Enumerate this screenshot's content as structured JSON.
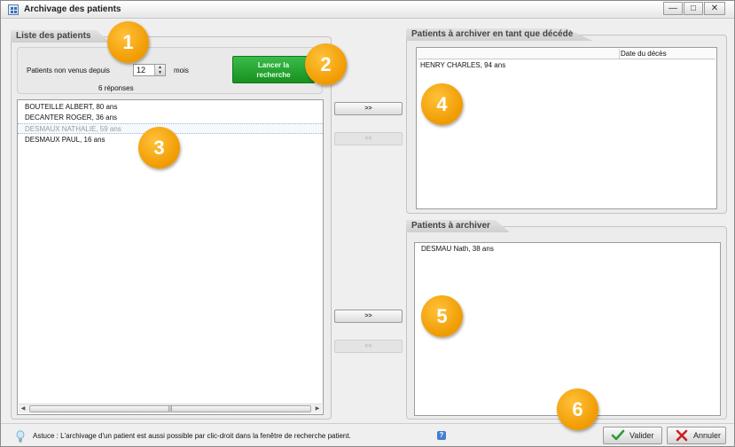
{
  "window": {
    "title": "Archivage des patients",
    "controls": {
      "minimize": "—",
      "maximize": "□",
      "close": "✕"
    }
  },
  "search_group": {
    "title": "Liste des patients",
    "period_label": "Patients non venus depuis",
    "period_value": "12",
    "period_unit": "mois",
    "results_count": "6 réponses",
    "search_button": [
      "Lancer la",
      "recherche"
    ]
  },
  "patients_list": [
    "BOUTEILLE ALBERT, 80 ans",
    "DECANTER ROGER, 36 ans",
    "DESMAUX NATHALIE, 59 ans",
    "DESMAUX PAUL, 16 ans"
  ],
  "selected_index": 2,
  "transfer_buttons": {
    "add": ">>",
    "remove": "<<"
  },
  "deceased_group": {
    "title": "Patients à archiver en tant que décédé",
    "column_header": "Date du décès",
    "items": [
      "HENRY CHARLES, 94 ans"
    ]
  },
  "archive_group": {
    "title": "Patients à archiver",
    "items": [
      "DESMAU Nath, 38 ans"
    ]
  },
  "footer": {
    "tip": "Astuce : L'archivage d'un patient est aussi possible par clic-droit dans la fenêtre de recherche patient.",
    "help": "?",
    "validate_label": "Valider",
    "cancel_label": "Annuler"
  },
  "badges": [
    "1",
    "2",
    "3",
    "4",
    "5",
    "6"
  ],
  "colors": {
    "accent_green": "#17911f",
    "badge_orange": "#f09a00",
    "validate_check": "#2e9a3a",
    "cancel_cross": "#cc2020"
  }
}
